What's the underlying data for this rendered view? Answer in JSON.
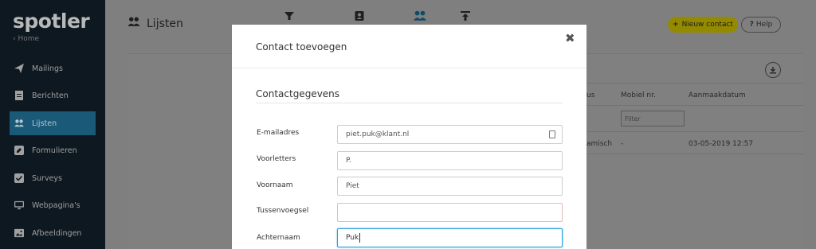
{
  "brand": {
    "logo": "spotler",
    "home": "Home"
  },
  "sidebar": {
    "items": [
      {
        "label": "Mailings",
        "icon": "paper-plane-icon"
      },
      {
        "label": "Berichten",
        "icon": "document-icon"
      },
      {
        "label": "Lijsten",
        "icon": "users-icon",
        "active": true
      },
      {
        "label": "Formulieren",
        "icon": "pencil-square-icon"
      },
      {
        "label": "Surveys",
        "icon": "checkbox-icon"
      },
      {
        "label": "Webpagina's",
        "icon": "monitor-icon"
      },
      {
        "label": "Afbeeldingen",
        "icon": "image-icon"
      }
    ]
  },
  "header": {
    "title": "Lijsten",
    "tab_icons": [
      "filter-icon",
      "contact-card-icon",
      "users-icon",
      "upload-icon"
    ],
    "new_contact": "Nieuw contact",
    "help": "Help"
  },
  "table": {
    "columns": [
      "us",
      "Mobiel nr.",
      "Aanmaakdatum"
    ],
    "filter_placeholder": "Filter",
    "row": {
      "status": "amisch",
      "mobile": "-",
      "created": "03-05-2019 12:57"
    }
  },
  "modal": {
    "title": "Contact toevoegen",
    "section": "Contactgegevens",
    "fields": [
      {
        "label": "E-mailadres",
        "value": "piet.puk@klant.nl"
      },
      {
        "label": "Voorletters",
        "value": "P."
      },
      {
        "label": "Voornaam",
        "value": "Piet"
      },
      {
        "label": "Tussenvoegsel",
        "value": ""
      },
      {
        "label": "Achternaam",
        "value": "Puk"
      }
    ],
    "close": "✖"
  },
  "colors": {
    "sidebar_bg": "#0d1820",
    "active_nav": "#1a5a78",
    "accent": "#948a00",
    "focus": "#2aa0d8"
  }
}
